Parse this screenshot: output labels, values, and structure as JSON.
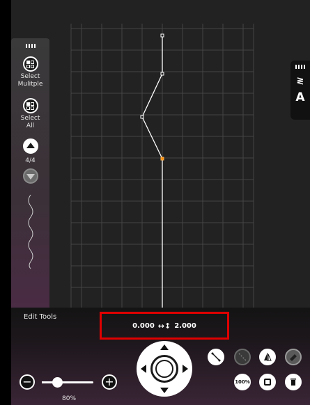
{
  "left_toolbar": {
    "select_multiple_label": "Select Mulitple",
    "select_all_label": "Select All",
    "page_indicator": "4/4"
  },
  "right_toolbar": {
    "text_tool_label": "A"
  },
  "bottom_panel": {
    "edit_tools_label": "Edit Tools",
    "readout": {
      "x_value": "0.000",
      "y_value": "2.000",
      "arrows_symbol": "↔↕"
    },
    "zoom": {
      "value_label": "80%",
      "level": 0.3
    },
    "zoom_100_label": "100%"
  },
  "colors": {
    "canvas_background": "#222222",
    "grid_line": "#444444",
    "stitch_line": "#ffffff",
    "selected_point": "#ff8c00",
    "highlight_box": "#e00000"
  },
  "icons": {
    "select_multiple": "select-multiple-icon",
    "select_all": "select-all-icon",
    "page_up": "triangle-up-icon",
    "page_down": "triangle-down-icon",
    "stitch_preview": "wave-stitch-icon",
    "zigzag_tool": "zigzag-icon",
    "zoom_out": "minus-icon",
    "zoom_in": "plus-icon"
  }
}
